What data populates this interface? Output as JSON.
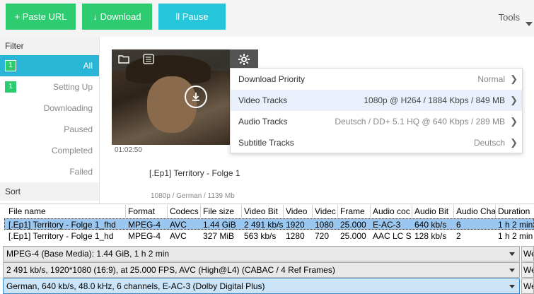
{
  "toolbar": {
    "paste_url": "+ Paste URL",
    "download": "↓ Download",
    "pause": "ll Pause",
    "tools": "Tools",
    "colors": {
      "green": "#2ecc71",
      "teal": "#26c6da"
    }
  },
  "sidebar": {
    "filter_heading": "Filter",
    "sort_heading": "Sort",
    "items": [
      {
        "label": "All",
        "badge": "1"
      },
      {
        "label": "Setting Up",
        "badge": "1"
      },
      {
        "label": "Downloading",
        "badge": ""
      },
      {
        "label": "Paused",
        "badge": ""
      },
      {
        "label": "Completed",
        "badge": ""
      },
      {
        "label": "Failed",
        "badge": ""
      }
    ]
  },
  "preview": {
    "time": "01:02:50",
    "title": "[.Ep1] Territory - Folge 1",
    "subtitle": "1080p / German / 1139 Mb"
  },
  "menu": {
    "rows": [
      {
        "label": "Download Priority",
        "value": "Normal"
      },
      {
        "label": "Video Tracks",
        "value": "1080p @ H264 / 1884 Kbps / 849 MB"
      },
      {
        "label": "Audio Tracks",
        "value": "Deutsch / DD+ 5.1 HQ @ 640 Kbps / 289 MB"
      },
      {
        "label": "Subtitle Tracks",
        "value": "Deutsch"
      }
    ]
  },
  "table": {
    "headers": [
      "File name",
      "Format",
      "Codecs",
      "File size",
      "Video Bit",
      "Video",
      "Videc",
      "Frame",
      "Audio coc",
      "Audio Bit",
      "Audio Cha",
      "Duration"
    ],
    "rows": [
      [
        "[.Ep1] Territory - Folge 1_fhd",
        "MPEG-4",
        "AVC",
        "1.44 GiB",
        "2 491 kb/s",
        "1920",
        "1080",
        "25.000",
        "E-AC-3",
        "640 kb/s",
        "6",
        "1 h 2 min"
      ],
      [
        "[.Ep1] Territory - Folge 1_hd",
        "MPEG-4",
        "AVC",
        "327 MiB",
        "563 kb/s",
        "1280",
        "720",
        "25.000",
        "AAC LC S",
        "128 kb/s",
        "2",
        "1 h 2 min"
      ]
    ]
  },
  "info": {
    "line1": "MPEG-4 (Base Media): 1.44 GiB, 1 h 2 min",
    "line2": "2 491 kb/s, 1920*1080 (16:9), at 25.000 FPS, AVC (High@L4) (CABAC / 4 Ref Frames)",
    "line3": "German, 640 kb/s, 48.0 kHz, 6 channels, E-AC-3 (Dolby Digital Plus)",
    "side": "We"
  }
}
